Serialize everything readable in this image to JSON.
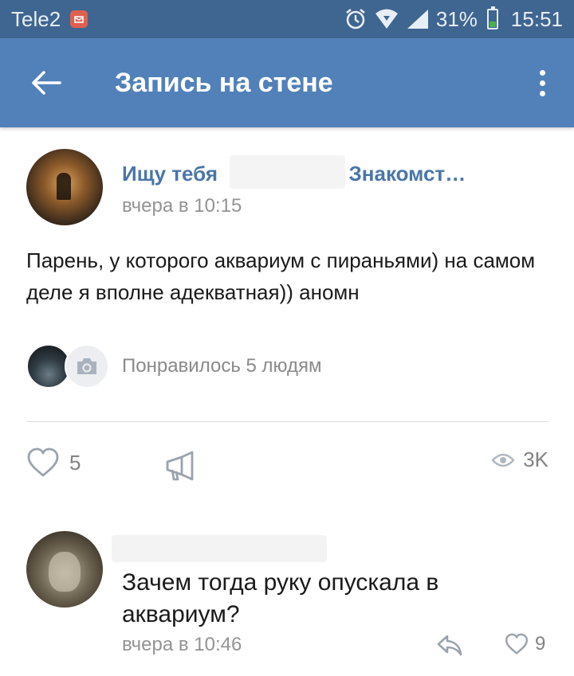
{
  "status_bar": {
    "carrier": "Tele2",
    "battery": "31%",
    "battery_level": 0.31,
    "time": "15:51"
  },
  "app_bar": {
    "title": "Запись на стене"
  },
  "post": {
    "author": "Ищу тебя",
    "author_suffix": ". Знакомст…",
    "time": "вчера в 10:15",
    "text": "Парень, у которого аквариум с пираньями) на самом деле я вполне адекватная)) аномн",
    "likes_text": "Понравилось 5 людям",
    "like_count": "5",
    "views": "3K"
  },
  "comment": {
    "text": "Зачем тогда руку опускала в аквариум?",
    "time": "вчера в 10:46",
    "like_count": "9"
  },
  "colors": {
    "status_bar": "#3f6591",
    "app_bar": "#5181b8",
    "link": "#4a76a8",
    "muted": "#939393"
  },
  "icons": [
    "back-arrow-icon",
    "more-vertical-icon",
    "alarm-icon",
    "wifi-icon",
    "signal-icon",
    "battery-icon",
    "camera-icon",
    "heart-icon",
    "share-icon",
    "eye-icon",
    "reply-icon"
  ]
}
